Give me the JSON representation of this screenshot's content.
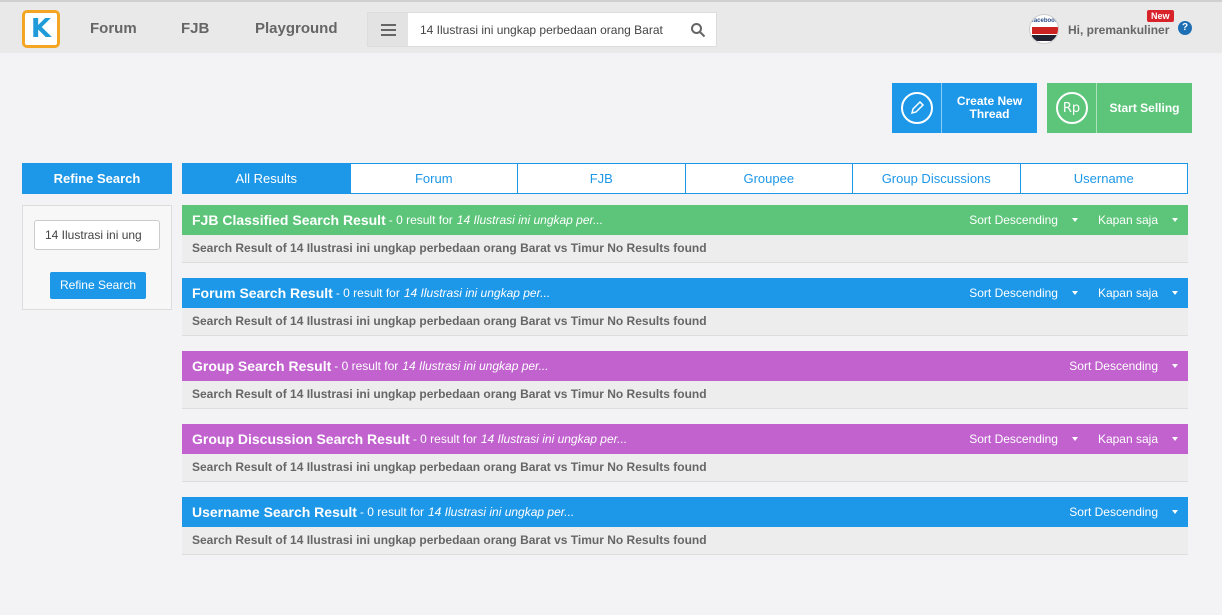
{
  "header": {
    "logo_text": "K",
    "nav": [
      "Forum",
      "FJB",
      "Playground"
    ],
    "search_value": "14 Ilustrasi ini ungkap perbedaan orang Barat",
    "greeting": "Hi, premankuliner",
    "new_badge": "New",
    "help": "?"
  },
  "actions": {
    "create": "Create New Thread",
    "sell": "Start Selling",
    "sell_icon": "Rp"
  },
  "refine": {
    "title": "Refine Search",
    "input_value": "14 Ilustrasi ini ung",
    "button": "Refine Search"
  },
  "tabs": [
    "All Results",
    "Forum",
    "FJB",
    "Groupee",
    "Group Discussions",
    "Username"
  ],
  "sections": [
    {
      "title": "FJB Classified Search Result",
      "meta": "- 0 result for",
      "query": "14 Ilustrasi ini ungkap per...",
      "sort": "Sort Descending",
      "time": "Kapan saja",
      "body": "Search Result of 14 Ilustrasi ini ungkap perbedaan orang Barat vs Timur No Results found"
    },
    {
      "title": "Forum Search Result",
      "meta": "- 0 result for",
      "query": "14 Ilustrasi ini ungkap per...",
      "sort": "Sort Descending",
      "time": "Kapan saja",
      "body": "Search Result of 14 Ilustrasi ini ungkap perbedaan orang Barat vs Timur No Results found"
    },
    {
      "title": "Group Search Result",
      "meta": "- 0 result for",
      "query": "14 Ilustrasi ini ungkap per...",
      "sort": "Sort Descending",
      "body": "Search Result of 14 Ilustrasi ini ungkap perbedaan orang Barat vs Timur No Results found"
    },
    {
      "title": "Group Discussion Search Result",
      "meta": "- 0 result for",
      "query": "14 Ilustrasi ini ungkap per...",
      "sort": "Sort Descending",
      "time": "Kapan saja",
      "body": "Search Result of 14 Ilustrasi ini ungkap perbedaan orang Barat vs Timur No Results found"
    },
    {
      "title": "Username Search Result",
      "meta": "- 0 result for",
      "query": "14 Ilustrasi ini ungkap per...",
      "sort": "Sort Descending",
      "body": "Search Result of 14 Ilustrasi ini ungkap perbedaan orang Barat vs Timur No Results found"
    }
  ],
  "colors": {
    "accent": "#1d97e8",
    "green": "#5cc57a",
    "purple": "#c162cf",
    "logo_border": "#f4a623",
    "badge": "#d9232b"
  }
}
